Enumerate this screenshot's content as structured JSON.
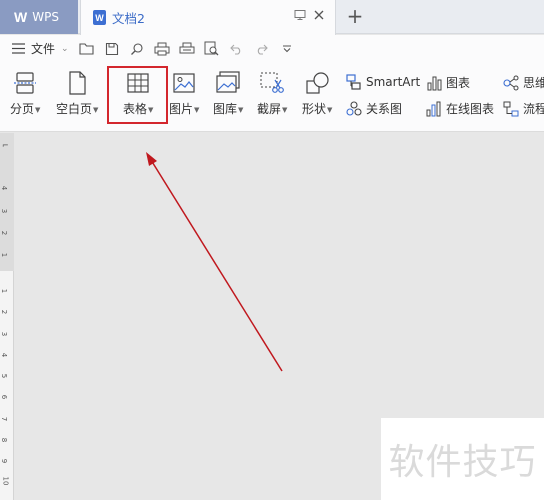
{
  "titlebar": {
    "app_tab": "WPS",
    "app_logo": "W",
    "doc_tab": "文档2",
    "doc_icon": "W",
    "new_tab": "+"
  },
  "quickbar": {
    "menu_label": "文件",
    "menu_chevron": "⌄",
    "icons": [
      "open-folder-icon",
      "save-icon",
      "find-icon",
      "print-icon",
      "print-preview-icon",
      "zoom-preview-icon",
      "undo-icon",
      "redo-icon",
      "more-chevron-icon"
    ]
  },
  "ribbon": {
    "page_break": "分页",
    "blank_page": "空白页",
    "table": "表格",
    "picture": "图片",
    "gallery": "图库",
    "screenshot": "截屏",
    "shapes": "形状",
    "smartart": "SmartArt",
    "chart": "图表",
    "relation": "关系图",
    "online_chart": "在线图表",
    "mindmap": "思维",
    "flowchart": "流程"
  },
  "ruler": {
    "numbers": [
      "4",
      "3",
      "2",
      "1",
      "1",
      "2",
      "3",
      "4",
      "5",
      "6",
      "7",
      "8",
      "9",
      "10"
    ]
  },
  "watermark": "软件技巧",
  "colors": {
    "highlight": "#d3262d",
    "arrow": "#c0181e",
    "wps_tab": "#8a9bc2",
    "doc_blue": "#3d6fd2"
  }
}
